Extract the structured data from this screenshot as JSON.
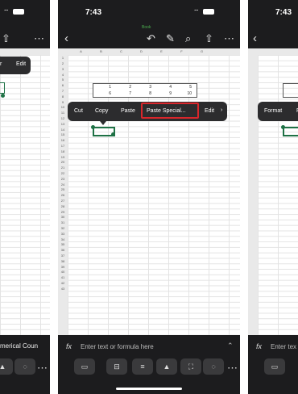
{
  "left": {
    "menu": [
      "r",
      "Edit"
    ],
    "footer_text": "merical Coun"
  },
  "center": {
    "time": "7:43",
    "app_badge": "Book",
    "columns": [
      "A",
      "B",
      "C",
      "D",
      "E",
      "F",
      "G"
    ],
    "rows": [
      "1",
      "2",
      "3",
      "4",
      "5",
      "6",
      "7",
      "8",
      "9",
      "10",
      "11",
      "12",
      "13",
      "14",
      "15",
      "16",
      "17",
      "18",
      "19",
      "20",
      "21",
      "22",
      "23",
      "24",
      "25",
      "26",
      "27",
      "28",
      "29",
      "30",
      "31",
      "32",
      "33",
      "34",
      "35",
      "36",
      "37",
      "38",
      "39",
      "40",
      "41",
      "42",
      "43"
    ],
    "table_values": [
      [
        "1",
        "2",
        "3",
        "4",
        "5"
      ],
      [
        "6",
        "7",
        "8",
        "9",
        "10"
      ]
    ],
    "menu": {
      "cut": "Cut",
      "copy": "Copy",
      "paste": "Paste",
      "paste_special": "Paste Special...",
      "edit": "Edit",
      "more": "›"
    },
    "formula_placeholder": "Enter text or formula here",
    "fx": "fx",
    "highlight_color": "#d9262b",
    "accent_color": "#1e7145"
  },
  "right": {
    "time": "7:43",
    "menu": [
      "Format",
      "F"
    ],
    "formula_placeholder": "Enter tex",
    "fx": "fx"
  }
}
